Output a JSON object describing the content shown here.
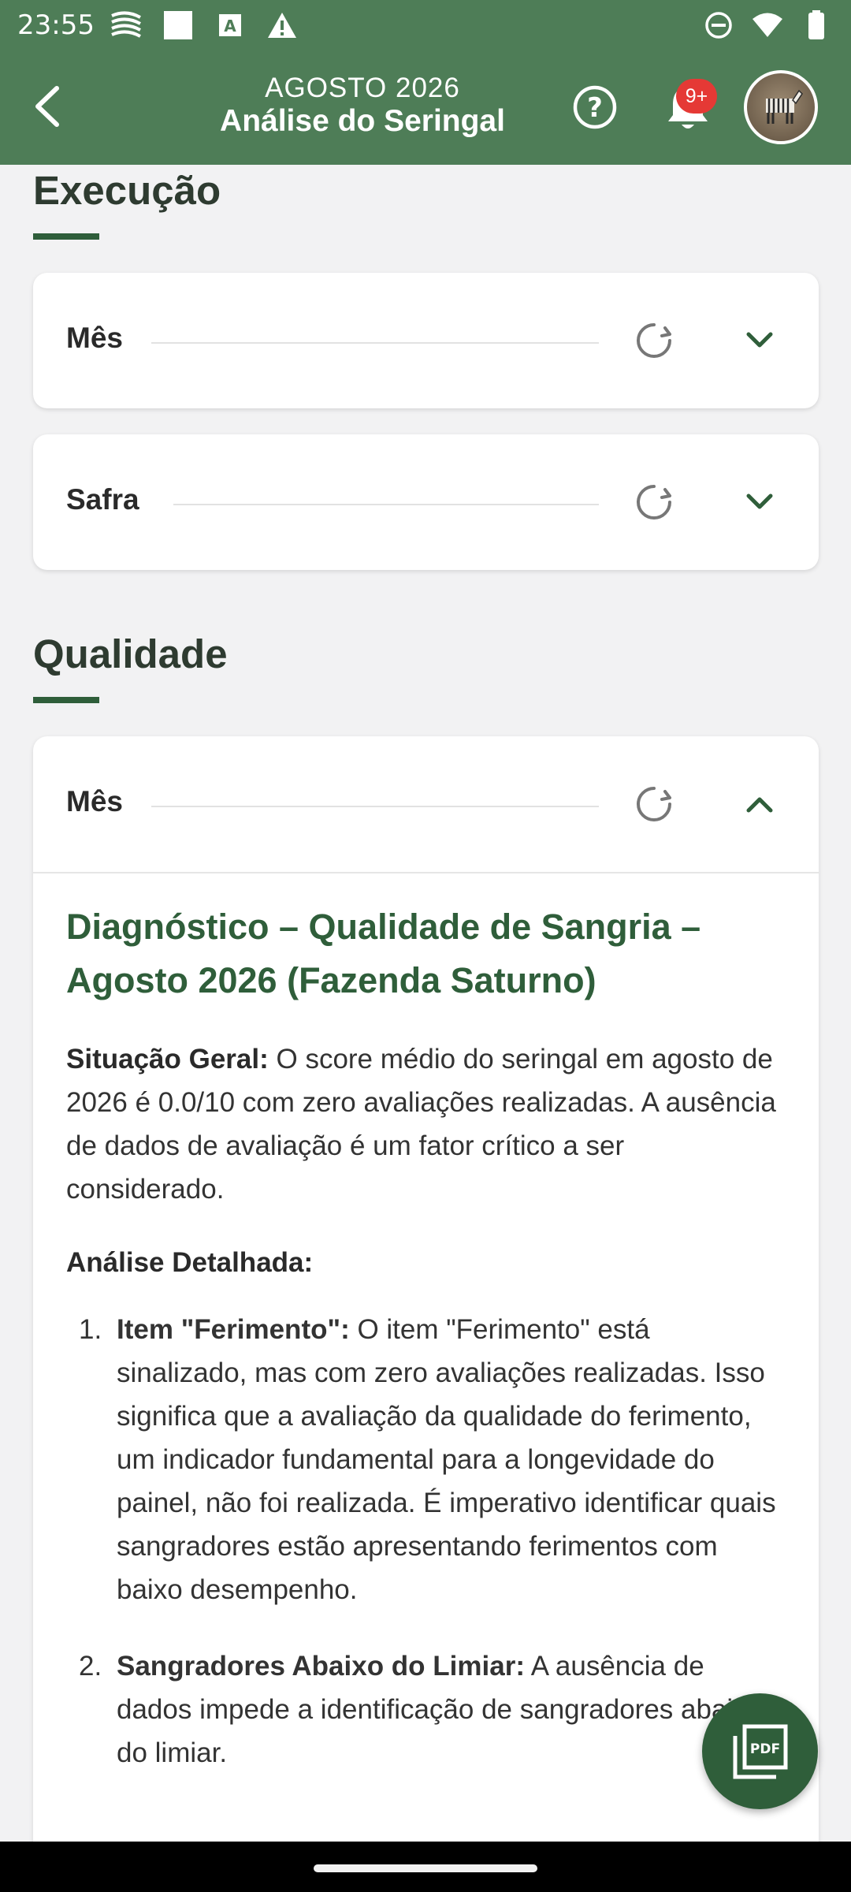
{
  "status_bar": {
    "time": "23:55",
    "left_icons": [
      "stacks-icon",
      "square-icon",
      "a-icon",
      "warning-icon"
    ],
    "right_icons": [
      "do-not-disturb-icon",
      "wifi-icon",
      "battery-icon"
    ]
  },
  "header": {
    "subtitle": "AGOSTO 2026",
    "title": "Análise do Seringal",
    "notification_badge": "9+"
  },
  "sections": {
    "execucao": {
      "title": "Execução",
      "cards": [
        {
          "label": "Mês"
        },
        {
          "label": "Safra"
        }
      ]
    },
    "qualidade": {
      "title": "Qualidade",
      "card": {
        "label": "Mês",
        "diagnostic_title": "Diagnóstico – Qualidade de Sangria – Agosto 2026 (Fazenda Saturno)",
        "situacao_label": "Situação Geral:",
        "situacao_text": " O score médio do seringal em agosto de 2026 é 0.0/10 com zero avaliações realizadas. A ausência de dados de avaliação é um fator crítico a ser considerado.",
        "analise_label": "Análise Detalhada:",
        "items": [
          {
            "number": "1.",
            "label": "Item \"Ferimento\":",
            "text": " O item \"Ferimento\" está sinalizado, mas com zero avaliações realizadas. Isso significa que a avaliação da qualidade do ferimento, um indicador fundamental para a longevidade do painel, não foi realizada. É imperativo identificar quais sangradores estão apresentando ferimentos com baixo desempenho."
          },
          {
            "number": "2.",
            "label": "Sangradores Abaixo do Limiar:",
            "text": " A ausência de dados impede a identificação de sangradores abaixo do limiar."
          }
        ]
      }
    }
  },
  "colors": {
    "header_bg": "#4e7d57",
    "accent_dark_green": "#2f5e3a",
    "badge_red": "#e53935"
  }
}
